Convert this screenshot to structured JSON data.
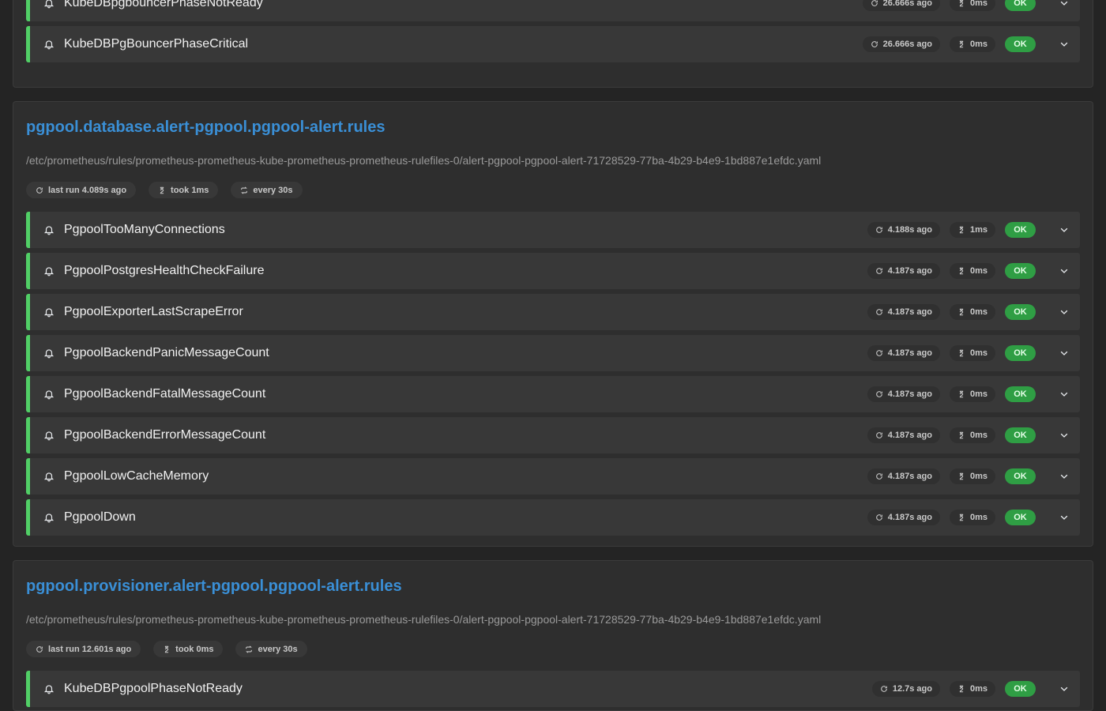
{
  "colors": {
    "background": "#242424",
    "card": "#2e2e2e",
    "row": "#383838",
    "accent_link": "#3a8fd6",
    "health_bar": "#51cf66",
    "ok_badge": "#2f9e44"
  },
  "groups": [
    {
      "title": "",
      "file": "",
      "last_run": "",
      "took": "",
      "every": "",
      "rules": [
        {
          "name": "KubeDBpgbouncerPhaseNotReady",
          "last_eval": "26.666s ago",
          "duration": "0ms",
          "health": "OK"
        },
        {
          "name": "KubeDBPgBouncerPhaseCritical",
          "last_eval": "26.666s ago",
          "duration": "0ms",
          "health": "OK"
        }
      ]
    },
    {
      "title": "pgpool.database.alert-pgpool.pgpool-alert.rules",
      "file": "/etc/prometheus/rules/prometheus-prometheus-kube-prometheus-prometheus-rulefiles-0/alert-pgpool-pgpool-alert-71728529-77ba-4b29-b4e9-1bd887e1efdc.yaml",
      "last_run": "last run 4.089s ago",
      "took": "took 1ms",
      "every": "every 30s",
      "rules": [
        {
          "name": "PgpoolTooManyConnections",
          "last_eval": "4.188s ago",
          "duration": "1ms",
          "health": "OK"
        },
        {
          "name": "PgpoolPostgresHealthCheckFailure",
          "last_eval": "4.187s ago",
          "duration": "0ms",
          "health": "OK"
        },
        {
          "name": "PgpoolExporterLastScrapeError",
          "last_eval": "4.187s ago",
          "duration": "0ms",
          "health": "OK"
        },
        {
          "name": "PgpoolBackendPanicMessageCount",
          "last_eval": "4.187s ago",
          "duration": "0ms",
          "health": "OK"
        },
        {
          "name": "PgpoolBackendFatalMessageCount",
          "last_eval": "4.187s ago",
          "duration": "0ms",
          "health": "OK"
        },
        {
          "name": "PgpoolBackendErrorMessageCount",
          "last_eval": "4.187s ago",
          "duration": "0ms",
          "health": "OK"
        },
        {
          "name": "PgpoolLowCacheMemory",
          "last_eval": "4.187s ago",
          "duration": "0ms",
          "health": "OK"
        },
        {
          "name": "PgpoolDown",
          "last_eval": "4.187s ago",
          "duration": "0ms",
          "health": "OK"
        }
      ]
    },
    {
      "title": "pgpool.provisioner.alert-pgpool.pgpool-alert.rules",
      "file": "/etc/prometheus/rules/prometheus-prometheus-kube-prometheus-prometheus-rulefiles-0/alert-pgpool-pgpool-alert-71728529-77ba-4b29-b4e9-1bd887e1efdc.yaml",
      "last_run": "last run 12.601s ago",
      "took": "took 0ms",
      "every": "every 30s",
      "rules": [
        {
          "name": "KubeDBPgpoolPhaseNotReady",
          "last_eval": "12.7s ago",
          "duration": "0ms",
          "health": "OK"
        }
      ]
    }
  ]
}
